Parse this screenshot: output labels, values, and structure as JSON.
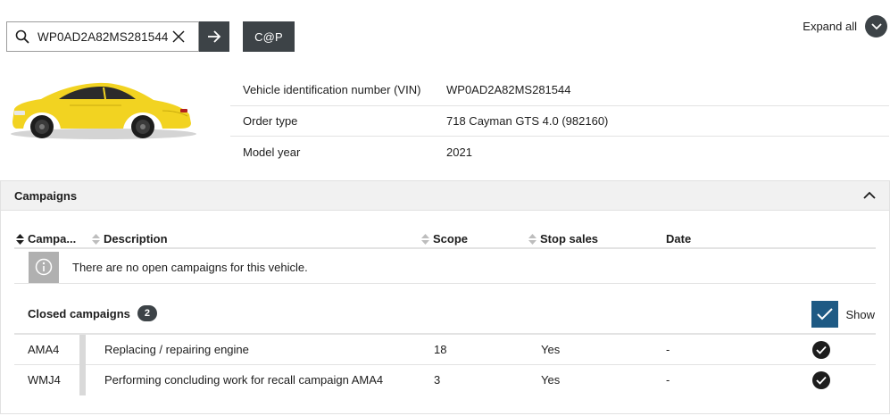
{
  "search": {
    "value": "WP0AD2A82MS281544",
    "cap_label": "C@P"
  },
  "header": {
    "expand_all_label": "Expand all"
  },
  "vehicle": {
    "rows": [
      {
        "label": "Vehicle identification number (VIN)",
        "value": "WP0AD2A82MS281544"
      },
      {
        "label": "Order type",
        "value": "718 Cayman GTS 4.0 (982160)"
      },
      {
        "label": "Model year",
        "value": "2021"
      }
    ],
    "car_color": "#f2d321"
  },
  "campaigns": {
    "title": "Campaigns",
    "columns": {
      "campaign": "Campa...",
      "description": "Description",
      "scope": "Scope",
      "stop_sales": "Stop sales",
      "date": "Date"
    },
    "no_open_text": "There are no open campaigns for this vehicle.",
    "closed_label": "Closed campaigns",
    "closed_count": "2",
    "show_label": "Show",
    "show_checked": true,
    "closed_rows": [
      {
        "campaign": "AMA4",
        "description": "Replacing / repairing engine",
        "scope": "18",
        "stop_sales": "Yes",
        "date": "-",
        "completed": true
      },
      {
        "campaign": "WMJ4",
        "description": "Performing concluding work for recall campaign AMA4",
        "scope": "3",
        "stop_sales": "Yes",
        "date": "-",
        "completed": true
      }
    ]
  },
  "colors": {
    "button_dark": "#3d4347",
    "checkbox_blue": "#1e5a84",
    "panel_header_bg": "#f1f1f1"
  }
}
